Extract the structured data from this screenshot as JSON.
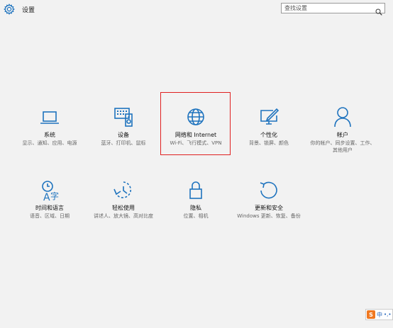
{
  "window": {
    "title": "设置"
  },
  "search": {
    "placeholder": "查找设置"
  },
  "tiles": [
    {
      "label": "系统",
      "desc": "显示、通知、应用、电源",
      "icon": "laptop-icon"
    },
    {
      "label": "设备",
      "desc": "蓝牙、打印机、鼠标",
      "icon": "devices-icon"
    },
    {
      "label": "网络和 Internet",
      "desc": "Wi-Fi、飞行模式、VPN",
      "icon": "globe-icon",
      "selected": true
    },
    {
      "label": "个性化",
      "desc": "背景、锁屏、颜色",
      "icon": "personalization-icon"
    },
    {
      "label": "帐户",
      "desc": "你的帐户、同步设置、工作、其他用户",
      "icon": "person-icon"
    },
    {
      "label": "时间和语言",
      "desc": "语音、区域、日期",
      "icon": "time-language-icon"
    },
    {
      "label": "轻松使用",
      "desc": "讲述人、放大镜、高对比度",
      "icon": "ease-of-access-icon"
    },
    {
      "label": "隐私",
      "desc": "位置、相机",
      "icon": "lock-icon"
    },
    {
      "label": "更新和安全",
      "desc": "Windows 更新、恢复、备份",
      "icon": "refresh-icon"
    }
  ],
  "ime": {
    "lang": "中",
    "extra": "•,•"
  },
  "colors": {
    "accent": "#1e73be",
    "selection": "#e02020",
    "background": "#f2f2f2"
  }
}
